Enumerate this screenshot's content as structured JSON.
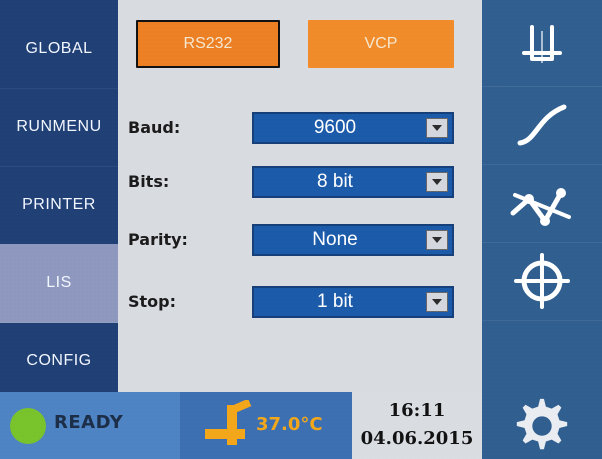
{
  "left_nav": {
    "items": [
      {
        "label": "GLOBAL"
      },
      {
        "label": "RUNMENU"
      },
      {
        "label": "PRINTER"
      },
      {
        "label": "LIS"
      },
      {
        "label": "CONFIG"
      }
    ],
    "active_index": 3
  },
  "main": {
    "modes": {
      "rs232": "RS232",
      "vcp": "VCP",
      "selected": "RS232"
    },
    "settings": [
      {
        "label": "Baud:",
        "value": "9600"
      },
      {
        "label": "Bits:",
        "value": "8 bit"
      },
      {
        "label": "Parity:",
        "value": "None"
      },
      {
        "label": "Stop:",
        "value": "1 bit"
      }
    ]
  },
  "right_tools": [
    {
      "icon": "cuvette-icon"
    },
    {
      "icon": "curve-icon"
    },
    {
      "icon": "graph-icon"
    },
    {
      "icon": "crosshair-icon"
    },
    {
      "icon": "gear-icon"
    }
  ],
  "status": {
    "ready": "READY",
    "temperature": "37.0°C",
    "time": "16:11",
    "date": "04.06.2015"
  },
  "colors": {
    "nav_bg": "#1f3f75",
    "nav_active": "#8e98be",
    "panel_bg": "#d8dbe0",
    "orange": "#f18b2a",
    "field_blue": "#1b5aa9",
    "status_green": "#78c22b",
    "temp_orange": "#f3a61a"
  }
}
